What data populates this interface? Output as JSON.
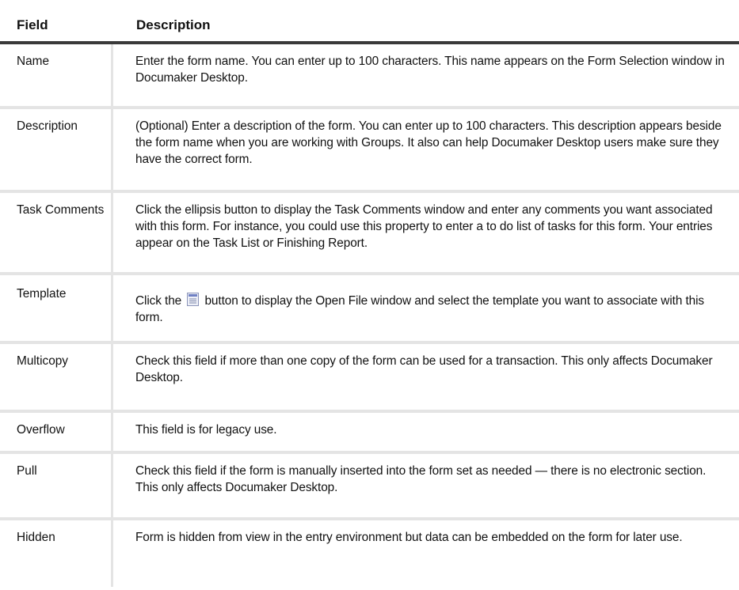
{
  "table": {
    "headers": {
      "field": "Field",
      "description": "Description"
    },
    "rows": [
      {
        "field": "Name",
        "description": "Enter the form name. You can enter up to 100 characters. This name appears on the Form Selection window in Documaker Desktop."
      },
      {
        "field": "Description",
        "description": "(Optional) Enter a description of the form. You can enter up to 100 characters. This description appears beside the form name when you are working with Groups. It also can help Documaker Desktop users make sure they have the correct form."
      },
      {
        "field": "Task Comments",
        "description": "Click the ellipsis button to display the Task Comments window and enter any comments you want associated with this form. For instance, you could use this property to enter a to do list of tasks for this form. Your entries appear on the Task List or Finishing Report."
      },
      {
        "field": "Template",
        "description_before_icon": "Click the",
        "description_after_icon": "button to display the Open File window and select the template you want to associate with this form.",
        "icon": "open-file-icon"
      },
      {
        "field": "Multicopy",
        "description": "Check this field if more than one copy of the form can be used for a transaction. This only affects Documaker Desktop."
      },
      {
        "field": "Overflow",
        "description": "This field is for legacy use."
      },
      {
        "field": "Pull",
        "description": "Check this field if the form is manually inserted into the form set as needed — there is no electronic section. This only affects Documaker Desktop."
      },
      {
        "field": "Hidden",
        "description": "Form is hidden from view in the entry environment but data can be embedded on the form for later use."
      }
    ]
  }
}
